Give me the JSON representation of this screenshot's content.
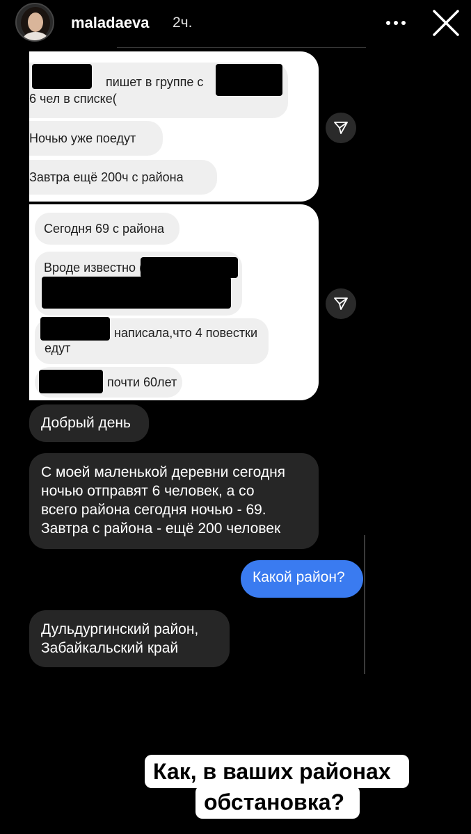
{
  "header": {
    "username": "maladaeva",
    "time_ago": "2ч.",
    "more_icon": "ellipsis-icon",
    "close_icon": "close-icon"
  },
  "screenshot_1": {
    "messages": [
      "пишет в группе с",
      "6 чел в списке(",
      "Ночью уже поедут",
      "Завтра ещё 200ч с района"
    ]
  },
  "screenshot_2": {
    "messages": [
      "Сегодня 69 с района",
      "Вроде известно (",
      "написала,что 4 повестки",
      "едут",
      "почти 60лет"
    ]
  },
  "chat": {
    "received_1": "Добрый день",
    "received_2": [
      "С моей маленькой деревни сегодня",
      "ночью отправят 6 человек, а со",
      "всего района сегодня ночью - 69.",
      "Завтра с района - ещё 200 человек"
    ],
    "sent_1": "Какой район?",
    "received_3": [
      "Дульдургинский район,",
      "Забайкальский край"
    ]
  },
  "caption": {
    "line_1": "Как, в ваших районах",
    "line_2": "обстановка?"
  },
  "icons": {
    "share": "paper-plane-icon",
    "avatar": "avatar"
  },
  "colors": {
    "background": "#000000",
    "received_bubble": "#262626",
    "sent_bubble": "#3a7bf0",
    "screenshot_bubble": "#efefef"
  }
}
